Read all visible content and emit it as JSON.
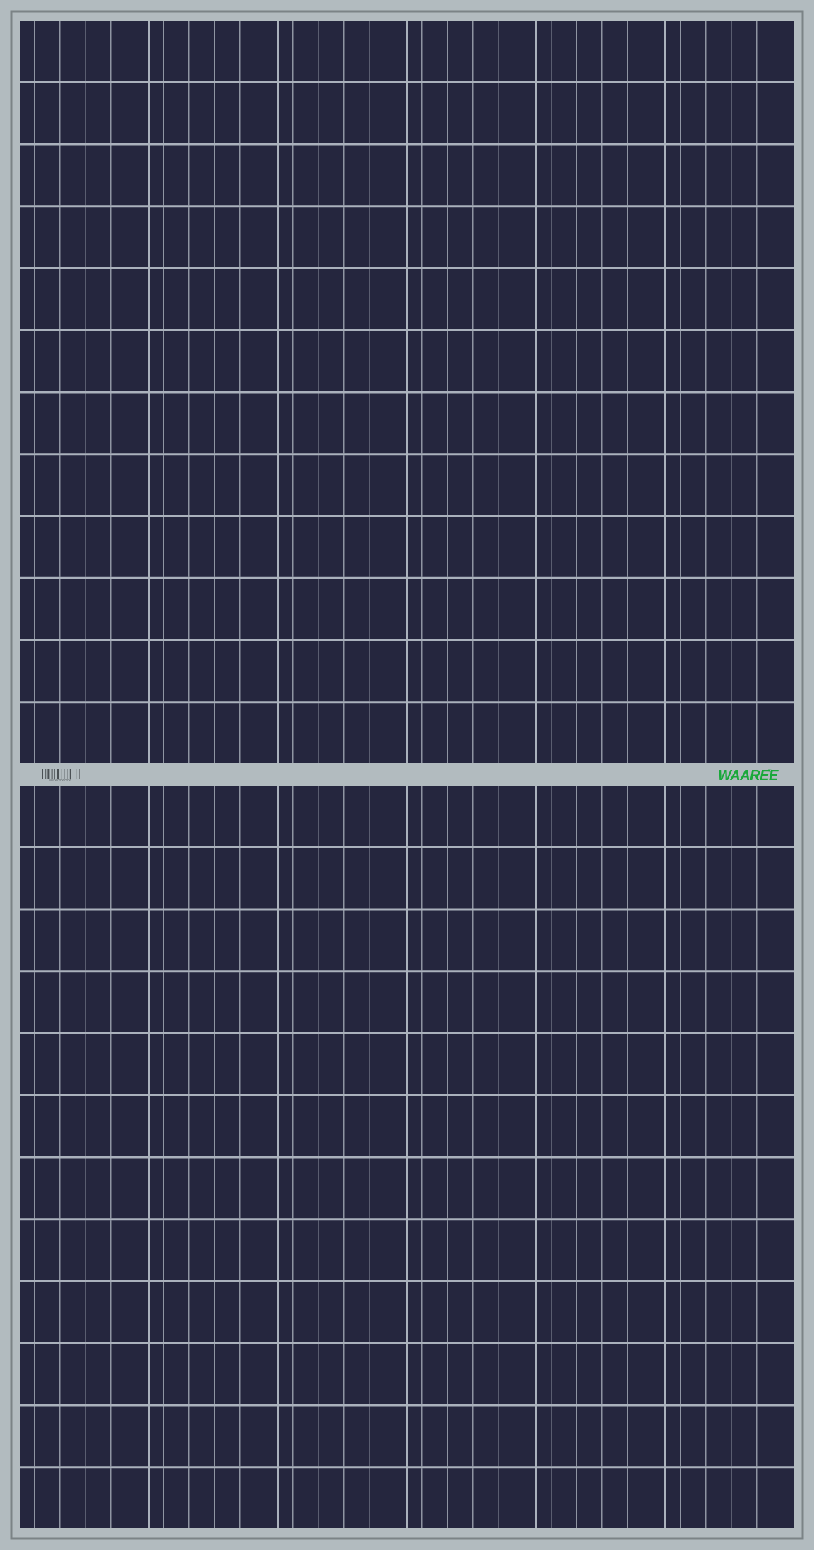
{
  "panel": {
    "kind": "solar-panel-front-view",
    "brand": {
      "text": "WAAREE",
      "trademark": "®",
      "color": "#1aa83a"
    },
    "barcode": {
      "caption": "WS0000000000"
    },
    "colors": {
      "frame": "#b2bbbf",
      "frame_edge": "#7b8386",
      "cell": "#25263e",
      "grid": "#aab1bc"
    },
    "halves": 2,
    "cell_rows_per_half": 12,
    "cell_columns": 6,
    "fingers_per_cell": 5
  }
}
